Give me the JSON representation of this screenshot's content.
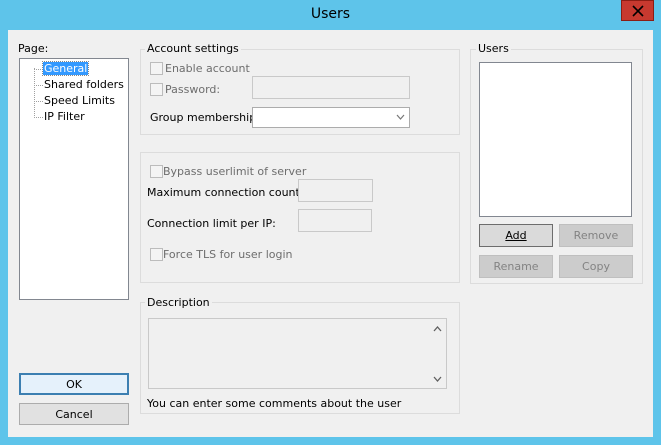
{
  "window": {
    "title": "Users"
  },
  "page_panel": {
    "label": "Page:",
    "items": [
      "General",
      "Shared folders",
      "Speed Limits",
      "IP Filter"
    ],
    "selected_index": 0
  },
  "account_settings": {
    "label": "Account settings",
    "enable_account": "Enable account",
    "password": "Password:",
    "group_membership": "Group membership:"
  },
  "limits": {
    "bypass": "Bypass userlimit of server",
    "max_conn": "Maximum connection count:",
    "conn_per_ip": "Connection limit per IP:",
    "force_tls": "Force TLS for user login"
  },
  "description": {
    "label": "Description",
    "hint": "You can enter some comments about the user"
  },
  "users": {
    "label": "Users",
    "buttons": {
      "add": "Add",
      "remove": "Remove",
      "rename": "Rename",
      "copy": "Copy"
    }
  },
  "dialog_buttons": {
    "ok": "OK",
    "cancel": "Cancel"
  }
}
